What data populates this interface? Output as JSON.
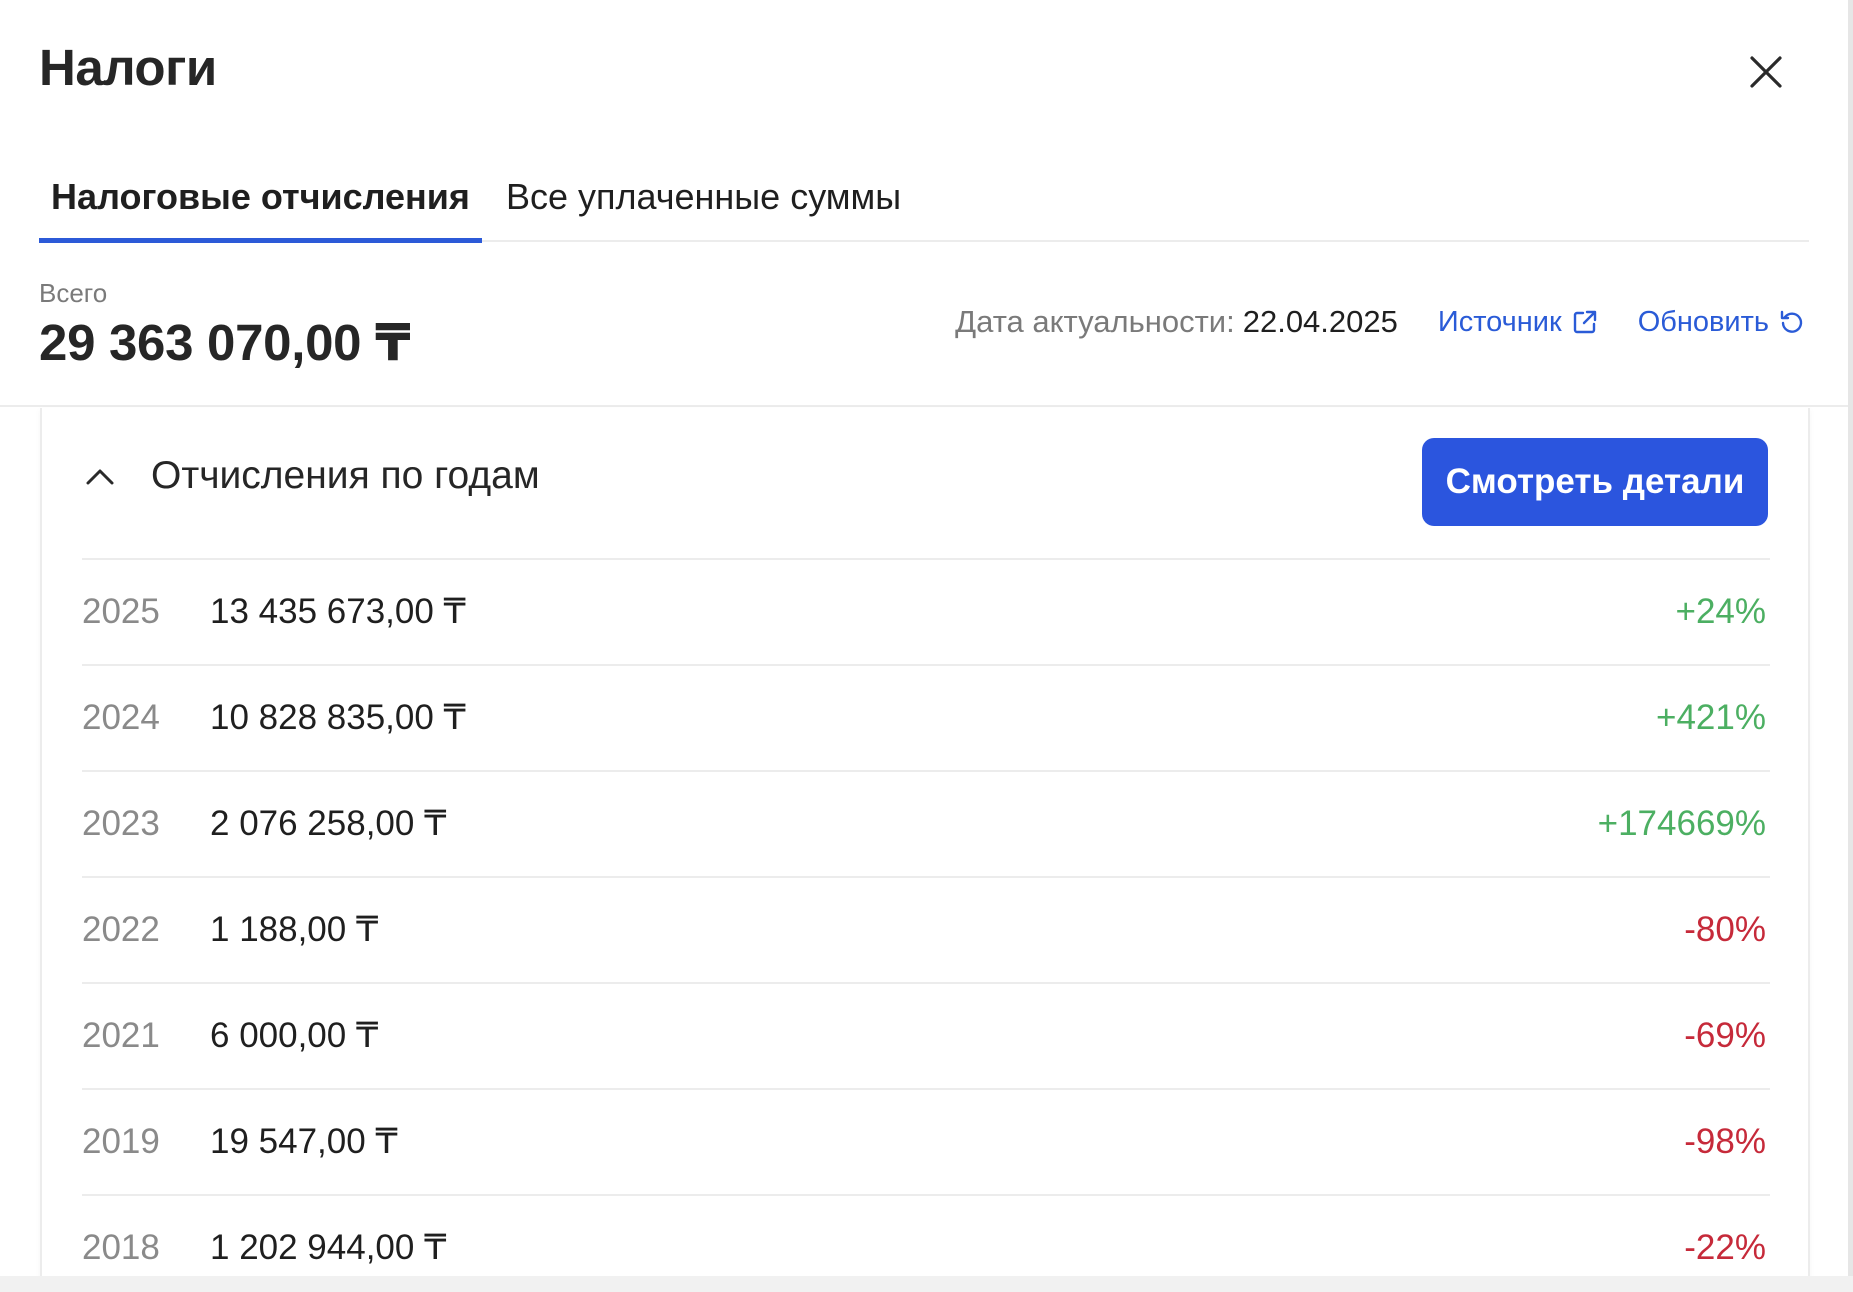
{
  "header": {
    "title": "Налоги",
    "close_icon": "close-icon"
  },
  "tabs": [
    {
      "label": "Налоговые отчисления",
      "active": true
    },
    {
      "label": "Все уплаченные суммы",
      "active": false
    }
  ],
  "summary": {
    "total_label": "Всего",
    "total_value": "29 363 070,00 ₸",
    "date_label": "Дата актуальности:",
    "date_value": "22.04.2025",
    "source_label": "Источник",
    "source_icon": "external-link-icon",
    "refresh_label": "Обновить",
    "refresh_icon": "refresh-icon"
  },
  "section": {
    "title": "Отчисления по годам",
    "toggle_icon": "chevron-up-icon",
    "details_button": "Смотреть детали",
    "rows": [
      {
        "year": "2025",
        "amount": "13 435 673,00 ₸",
        "change": "+24%",
        "trend": "positive"
      },
      {
        "year": "2024",
        "amount": "10 828 835,00 ₸",
        "change": "+421%",
        "trend": "positive"
      },
      {
        "year": "2023",
        "amount": "2 076 258,00 ₸",
        "change": "+174669%",
        "trend": "positive"
      },
      {
        "year": "2022",
        "amount": "1 188,00 ₸",
        "change": "-80%",
        "trend": "negative"
      },
      {
        "year": "2021",
        "amount": "6 000,00 ₸",
        "change": "-69%",
        "trend": "negative"
      },
      {
        "year": "2019",
        "amount": "19 547,00 ₸",
        "change": "-98%",
        "trend": "negative"
      },
      {
        "year": "2018",
        "amount": "1 202 944,00 ₸",
        "change": "-22%",
        "trend": "negative"
      }
    ]
  },
  "colors": {
    "accent": "#2c5ad8",
    "button": "#2b55de",
    "positive": "#4caf62",
    "negative": "#c62a3a",
    "muted": "#7a7a7a"
  }
}
